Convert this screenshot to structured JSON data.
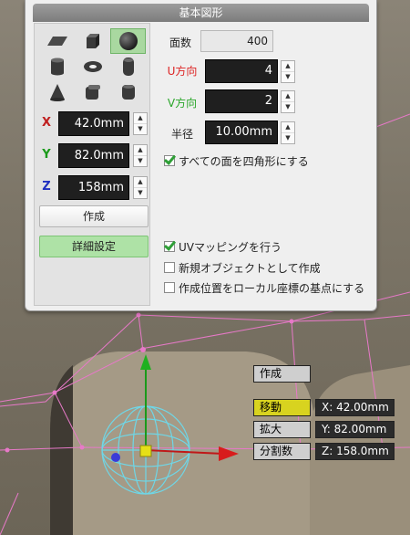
{
  "panel": {
    "title": "基本図形",
    "shapes": [
      {
        "icon": "plane-icon"
      },
      {
        "icon": "cube-icon"
      },
      {
        "icon": "sphere-icon",
        "selected": true
      },
      {
        "icon": "cylinder-icon"
      },
      {
        "icon": "torus-icon"
      },
      {
        "icon": "capsule-icon"
      },
      {
        "icon": "cone-icon"
      },
      {
        "icon": "rounded-cube-icon"
      },
      {
        "icon": "rounded-cylinder-icon"
      }
    ],
    "coords": {
      "x_label": "X",
      "x_value": "42.0mm",
      "y_label": "Y",
      "y_value": "82.0mm",
      "z_label": "Z",
      "z_value": "158mm"
    },
    "create_label": "作成",
    "detail_label": "詳細設定",
    "params": {
      "faces_label": "面数",
      "faces_value": "400",
      "u_label": "U方向",
      "u_value": "4",
      "v_label": "V方向",
      "v_value": "2",
      "radius_label": "半径",
      "radius_value": "10.00mm"
    },
    "checks": {
      "quad_label": "すべての面を四角形にする",
      "uv_label": "UVマッピングを行う",
      "new_object_label": "新規オブジェクトとして作成",
      "local_origin_label": "作成位置をローカル座標の基点にする"
    }
  },
  "viewport": {
    "create_label": "作成",
    "move_label": "移動",
    "scale_label": "拡大",
    "subdivide_label": "分割数",
    "x_readout": "X: 42.00mm",
    "y_readout": "Y: 82.00mm",
    "z_readout": "Z: 158.0mm"
  },
  "colors": {
    "accent_green": "#aee2a6",
    "field_dark": "#1f1f1f",
    "wire_pink": "#e779c8",
    "sphere_cyan": "#6fd6e6",
    "active_yellow": "#d8d31f"
  }
}
